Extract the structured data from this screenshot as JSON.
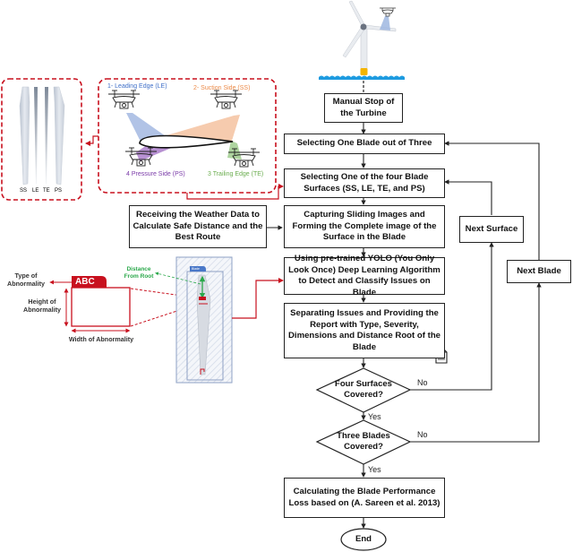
{
  "flowchart": {
    "steps": {
      "manual_stop": "Manual Stop of the Turbine",
      "select_blade": "Selecting One Blade out of Three",
      "select_surface": "Selecting One of the four Blade Surfaces (SS, LE, TE, and PS)",
      "weather": "Receiving the Weather Data to Calculate Safe Distance and the Best Route",
      "capture": "Capturing Sliding Images and Forming the Complete image of the Surface in the Blade",
      "yolo": "Using pre-trained YOLO (You Only Look Once) Deep Learning Algorithm to Detect and Classify Issues on Blade",
      "report": "Separating Issues and Providing the Report with Type, Severity, Dimensions and Distance Root of the Blade",
      "next_surface": "Next Surface",
      "next_blade": "Next Blade",
      "calc": "Calculating the Blade Performance Loss based on (A. Sareen et al. 2013)",
      "end": "End"
    },
    "decisions": {
      "four_surfaces": [
        "Four Surfaces",
        "Covered?"
      ],
      "three_blades": [
        "Three Blades",
        "Covered?"
      ]
    },
    "branch_labels": {
      "yes": "Yes",
      "no": "No"
    }
  },
  "blade_views": {
    "labels": [
      "SS",
      "LE",
      "TE",
      "PS"
    ]
  },
  "drone_panel": {
    "leading_edge": "1- Leading Edge (LE)",
    "suction_side": "2- Suction Side (SS)",
    "trailing_edge": "3  Trailing Edge (TE)",
    "pressure_side": "4  Pressure Side (PS)",
    "colors": {
      "le": "#7d9bd6",
      "ss": "#f0a878",
      "te": "#8cc276",
      "ps": "#9a62c0"
    }
  },
  "abnormality": {
    "tag": "ABC",
    "type_label": "Type of Abnormality",
    "height_label": "Height of Abnormality",
    "width_label": "Width of Abnormality",
    "distance_label": "Distance From Root",
    "blade_tag": "Blade"
  },
  "colors": {
    "accent_red": "#c8101e",
    "green": "#2aa84a",
    "water": "#1e9be0",
    "tower_base": "#f4b400"
  }
}
